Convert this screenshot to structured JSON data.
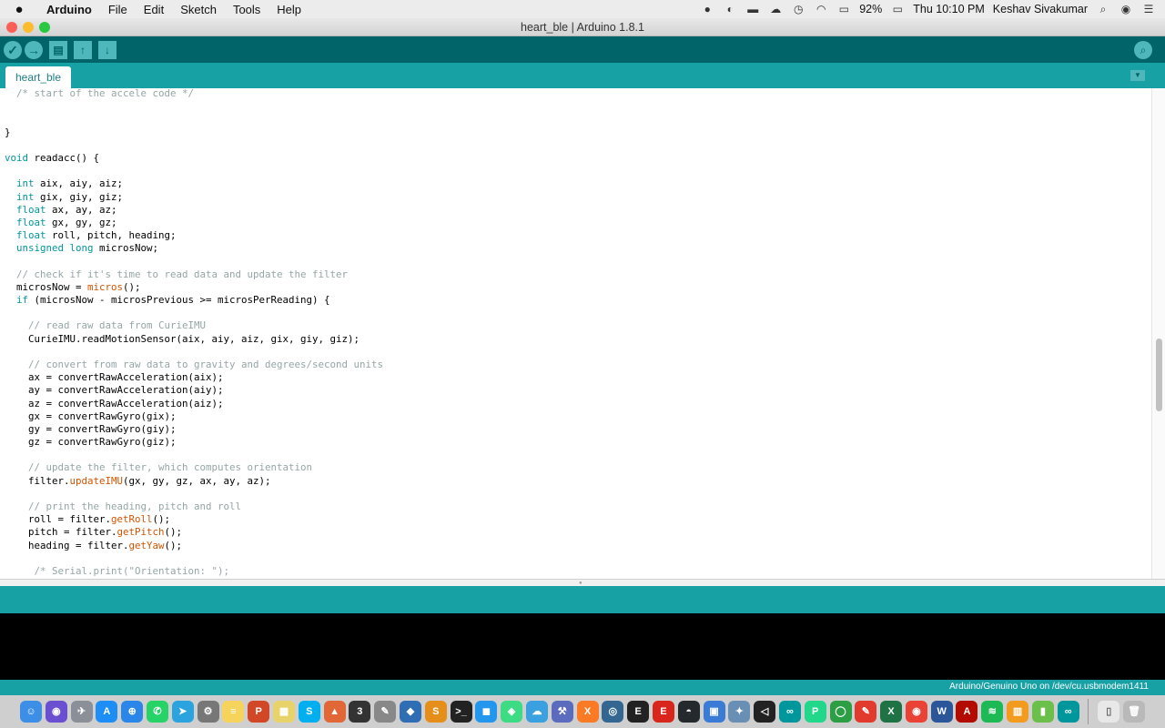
{
  "menubar": {
    "app_name": "Arduino",
    "menus": [
      "File",
      "Edit",
      "Sketch",
      "Tools",
      "Help"
    ],
    "battery": "92%",
    "clock": "Thu 10:10 PM",
    "user": "Keshav Sivakumar"
  },
  "window": {
    "title": "heart_ble | Arduino 1.8.1"
  },
  "toolbar": {
    "verify_icon": "✓",
    "upload_icon": "→",
    "new_icon": "▤",
    "open_icon": "↑",
    "save_icon": "↓",
    "monitor_icon": "⌕"
  },
  "tabs": {
    "active_label": "heart_ble",
    "menu_icon": "▼"
  },
  "status": {
    "board_port": "Arduino/Genuino Uno on /dev/cu.usbmodem1411"
  },
  "dock": {
    "icons": [
      {
        "name": "finder",
        "color": "#3d8ee6",
        "glyph": "☺"
      },
      {
        "name": "siri",
        "color": "#6b4fd1",
        "glyph": "◉"
      },
      {
        "name": "launchpad",
        "color": "#8a8f98",
        "glyph": "✈"
      },
      {
        "name": "app-store",
        "color": "#1e8ef7",
        "glyph": "A"
      },
      {
        "name": "safari",
        "color": "#2a86e8",
        "glyph": "⊕"
      },
      {
        "name": "whatsapp",
        "color": "#25d366",
        "glyph": "✆"
      },
      {
        "name": "telegram",
        "color": "#2aa3de",
        "glyph": "➤"
      },
      {
        "name": "system-preferences",
        "color": "#777",
        "glyph": "⚙"
      },
      {
        "name": "notes",
        "color": "#f6d35b",
        "glyph": "≡"
      },
      {
        "name": "powerpoint",
        "color": "#d24726",
        "glyph": "P"
      },
      {
        "name": "stickies",
        "color": "#e8d36b",
        "glyph": "▦"
      },
      {
        "name": "skype",
        "color": "#00aff0",
        "glyph": "S"
      },
      {
        "name": "matlab",
        "color": "#e16737",
        "glyph": "▲"
      },
      {
        "name": "app-3",
        "color": "#333",
        "glyph": "3"
      },
      {
        "name": "script-editor",
        "color": "#888",
        "glyph": "✎"
      },
      {
        "name": "app-blue",
        "color": "#2f6db5",
        "glyph": "◆"
      },
      {
        "name": "sublime",
        "color": "#e58f1a",
        "glyph": "S"
      },
      {
        "name": "terminal",
        "color": "#222",
        "glyph": ">_"
      },
      {
        "name": "docker",
        "color": "#2396ed",
        "glyph": "◼"
      },
      {
        "name": "android-studio",
        "color": "#3ddc84",
        "glyph": "◈"
      },
      {
        "name": "app-cloud",
        "color": "#3aa0e0",
        "glyph": "☁"
      },
      {
        "name": "app-tool",
        "color": "#5b6cbe",
        "glyph": "⚒"
      },
      {
        "name": "xampp",
        "color": "#fb7a24",
        "glyph": "X"
      },
      {
        "name": "postgres",
        "color": "#336791",
        "glyph": "◎"
      },
      {
        "name": "epic",
        "color": "#222",
        "glyph": "E"
      },
      {
        "name": "evo",
        "color": "#d9261c",
        "glyph": "E"
      },
      {
        "name": "github",
        "color": "#24292e",
        "glyph": "◓"
      },
      {
        "name": "app-folder",
        "color": "#3a7bd5",
        "glyph": "▣"
      },
      {
        "name": "app-star",
        "color": "#6a8fb5",
        "glyph": "✦"
      },
      {
        "name": "unity",
        "color": "#222",
        "glyph": "◁"
      },
      {
        "name": "arduino",
        "color": "#00979c",
        "glyph": "∞"
      },
      {
        "name": "pycharm",
        "color": "#21d789",
        "glyph": "P"
      },
      {
        "name": "app-ring",
        "color": "#2c9f45",
        "glyph": "◯"
      },
      {
        "name": "app-red",
        "color": "#e23b2e",
        "glyph": "✎"
      },
      {
        "name": "excel",
        "color": "#1f7244",
        "glyph": "X"
      },
      {
        "name": "chrome",
        "color": "#ea4335",
        "glyph": "◉"
      },
      {
        "name": "word",
        "color": "#2b579a",
        "glyph": "W"
      },
      {
        "name": "acrobat",
        "color": "#b30b00",
        "glyph": "A"
      },
      {
        "name": "spotify",
        "color": "#1db954",
        "glyph": "≋"
      },
      {
        "name": "ibooks",
        "color": "#f39b1f",
        "glyph": "▥"
      },
      {
        "name": "app-green",
        "color": "#6ac04b",
        "glyph": "▮"
      },
      {
        "name": "arduino-2",
        "color": "#00979c",
        "glyph": "∞"
      },
      {
        "name": "documents",
        "color": "#e8e8e8",
        "glyph": "▯"
      },
      {
        "name": "trash",
        "color": "#b9b9b9",
        "glyph": "🗑"
      }
    ]
  },
  "code": {
    "lines": [
      [
        {
          "t": "  "
        },
        {
          "t": "/* start of the accele code */",
          "c": "cm"
        }
      ],
      [],
      [],
      [
        {
          "t": "}"
        }
      ],
      [],
      [
        {
          "t": "void",
          "c": "kw"
        },
        {
          "t": " readacc() {"
        }
      ],
      [],
      [
        {
          "t": "  "
        },
        {
          "t": "int",
          "c": "kw"
        },
        {
          "t": " aix, aiy, aiz;"
        }
      ],
      [
        {
          "t": "  "
        },
        {
          "t": "int",
          "c": "kw"
        },
        {
          "t": " gix, giy, giz;"
        }
      ],
      [
        {
          "t": "  "
        },
        {
          "t": "float",
          "c": "kw"
        },
        {
          "t": " ax, ay, az;"
        }
      ],
      [
        {
          "t": "  "
        },
        {
          "t": "float",
          "c": "kw"
        },
        {
          "t": " gx, gy, gz;"
        }
      ],
      [
        {
          "t": "  "
        },
        {
          "t": "float",
          "c": "kw"
        },
        {
          "t": " roll, pitch, heading;"
        }
      ],
      [
        {
          "t": "  "
        },
        {
          "t": "unsigned long",
          "c": "kw"
        },
        {
          "t": " microsNow;"
        }
      ],
      [],
      [
        {
          "t": "  "
        },
        {
          "t": "// check if it's time to read data and update the filter",
          "c": "cm"
        }
      ],
      [
        {
          "t": "  microsNow = "
        },
        {
          "t": "micros",
          "c": "fn"
        },
        {
          "t": "();"
        }
      ],
      [
        {
          "t": "  "
        },
        {
          "t": "if",
          "c": "kw"
        },
        {
          "t": " (microsNow - microsPrevious >= microsPerReading) {"
        }
      ],
      [],
      [
        {
          "t": "    "
        },
        {
          "t": "// read raw data from CurieIMU",
          "c": "cm"
        }
      ],
      [
        {
          "t": "    CurieIMU.readMotionSensor(aix, aiy, aiz, gix, giy, giz);"
        }
      ],
      [],
      [
        {
          "t": "    "
        },
        {
          "t": "// convert from raw data to gravity and degrees/second units",
          "c": "cm"
        }
      ],
      [
        {
          "t": "    ax = convertRawAcceleration(aix);"
        }
      ],
      [
        {
          "t": "    ay = convertRawAcceleration(aiy);"
        }
      ],
      [
        {
          "t": "    az = convertRawAcceleration(aiz);"
        }
      ],
      [
        {
          "t": "    gx = convertRawGyro(gix);"
        }
      ],
      [
        {
          "t": "    gy = convertRawGyro(giy);"
        }
      ],
      [
        {
          "t": "    gz = convertRawGyro(giz);"
        }
      ],
      [],
      [
        {
          "t": "    "
        },
        {
          "t": "// update the filter, which computes orientation",
          "c": "cm"
        }
      ],
      [
        {
          "t": "    filter."
        },
        {
          "t": "updateIMU",
          "c": "fn"
        },
        {
          "t": "(gx, gy, gz, ax, ay, az);"
        }
      ],
      [],
      [
        {
          "t": "    "
        },
        {
          "t": "// print the heading, pitch and roll",
          "c": "cm"
        }
      ],
      [
        {
          "t": "    roll = filter."
        },
        {
          "t": "getRoll",
          "c": "fn"
        },
        {
          "t": "();"
        }
      ],
      [
        {
          "t": "    pitch = filter."
        },
        {
          "t": "getPitch",
          "c": "fn"
        },
        {
          "t": "();"
        }
      ],
      [
        {
          "t": "    heading = filter."
        },
        {
          "t": "getYaw",
          "c": "fn"
        },
        {
          "t": "();"
        }
      ],
      [],
      [
        {
          "t": "     "
        },
        {
          "t": "/* Serial.print(\"Orientation: \");",
          "c": "cm"
        }
      ]
    ]
  }
}
